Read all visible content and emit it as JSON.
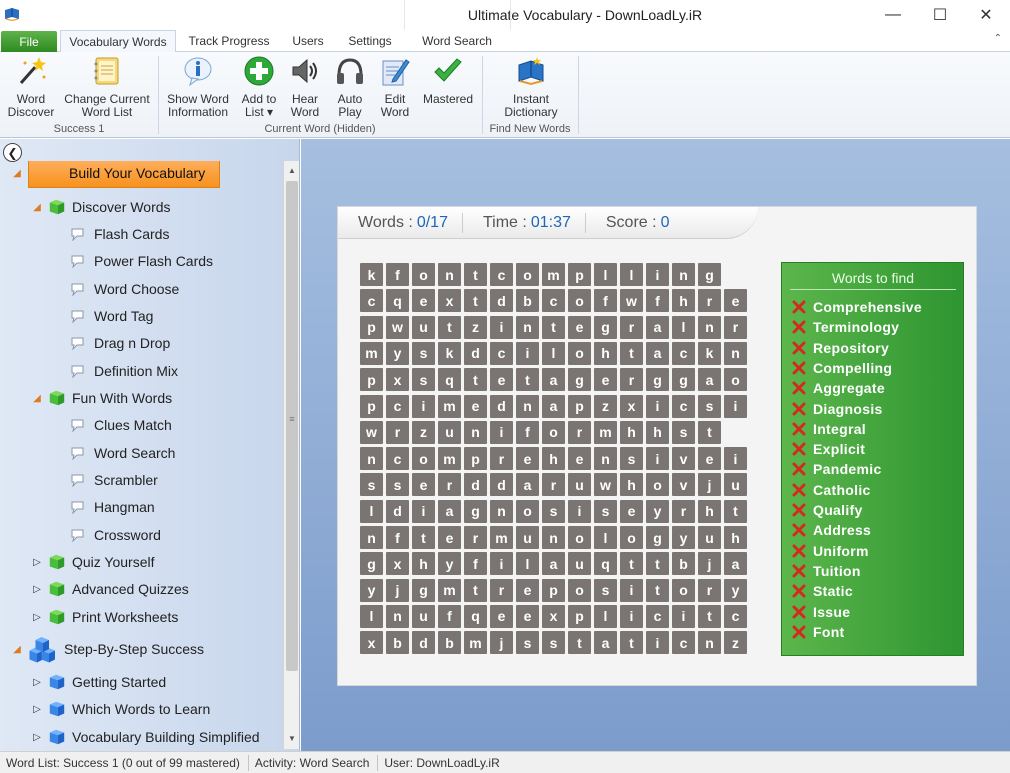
{
  "window": {
    "title": "Ultimate Vocabulary - DownLoadLy.iR",
    "minimize_glyph": "—",
    "maximize_glyph": "☐",
    "close_glyph": "✕"
  },
  "ribbon": {
    "file_label": "File",
    "tabs": [
      "Vocabulary Words",
      "Track Progress",
      "Users",
      "Settings",
      "Word Search"
    ],
    "active_tab": "Vocabulary Words",
    "collapse_glyph": "⌃",
    "buttons": {
      "word_discover": [
        "Word",
        "Discover"
      ],
      "change_list": [
        "Change Current",
        "Word List"
      ],
      "show_info": [
        "Show Word",
        "Information"
      ],
      "add_to_list": [
        "Add to",
        "List ▾"
      ],
      "hear_word": [
        "Hear",
        "Word"
      ],
      "auto_play": [
        "Auto",
        "Play"
      ],
      "edit_word": [
        "Edit",
        "Word"
      ],
      "mastered": [
        "Mastered",
        ""
      ],
      "instant_dictionary": [
        "Instant",
        "Dictionary"
      ]
    },
    "groups": {
      "success": "Success 1",
      "current_word": "Current Word (Hidden)",
      "find_new": "Find New Words"
    }
  },
  "tree": {
    "back_glyph": "❮",
    "items": [
      {
        "label": "Build Your Vocabulary",
        "level": 0,
        "arrow": "◢",
        "kind": "green-big",
        "selected": true
      },
      {
        "label": "Discover Words",
        "level": 1,
        "arrow": "◢",
        "kind": "green"
      },
      {
        "label": "Flash Cards",
        "level": 2,
        "kind": "leaf"
      },
      {
        "label": "Power Flash Cards",
        "level": 2,
        "kind": "leaf"
      },
      {
        "label": "Word Choose",
        "level": 2,
        "kind": "leaf"
      },
      {
        "label": "Word Tag",
        "level": 2,
        "kind": "leaf"
      },
      {
        "label": "Drag n Drop",
        "level": 2,
        "kind": "leaf"
      },
      {
        "label": "Definition Mix",
        "level": 2,
        "kind": "leaf"
      },
      {
        "label": "Fun With Words",
        "level": 1,
        "arrow": "◢",
        "kind": "green"
      },
      {
        "label": "Clues Match",
        "level": 2,
        "kind": "leaf"
      },
      {
        "label": "Word Search",
        "level": 2,
        "kind": "leaf"
      },
      {
        "label": "Scrambler",
        "level": 2,
        "kind": "leaf"
      },
      {
        "label": "Hangman",
        "level": 2,
        "kind": "leaf"
      },
      {
        "label": "Crossword",
        "level": 2,
        "kind": "leaf"
      },
      {
        "label": "Quiz Yourself",
        "level": 1,
        "arrow": "▷",
        "kind": "green"
      },
      {
        "label": "Advanced Quizzes",
        "level": 1,
        "arrow": "▷",
        "kind": "green"
      },
      {
        "label": "Print Worksheets",
        "level": 1,
        "arrow": "▷",
        "kind": "green"
      },
      {
        "label": "Step-By-Step Success",
        "level": 0,
        "arrow": "◢",
        "kind": "blue-big"
      },
      {
        "label": "Getting Started",
        "level": 1,
        "arrow": "▷",
        "kind": "blue"
      },
      {
        "label": "Which Words to Learn",
        "level": 1,
        "arrow": "▷",
        "kind": "blue"
      },
      {
        "label": "Vocabulary Building Simplified",
        "level": 1,
        "arrow": "▷",
        "kind": "blue"
      }
    ]
  },
  "game": {
    "words_label": "Words :",
    "words_value": "0/17",
    "time_label": "Time :",
    "time_value": "01:37",
    "score_label": "Score :",
    "score_value": "0",
    "grid": [
      "kfontcomplling",
      "cqextdbcofwfhre",
      "pwutzintegralnr",
      "myskdciloht ackn",
      "pxsqtetagerggao",
      "pcimednapzxicsi",
      "wrzunifor mhhst",
      "ncomprehensivei",
      "sserddaruwhovju",
      "ldiagnosiseyrht",
      "nftermunologyuh",
      "gxhyfilauqttbja",
      "yjgmtrepositor y",
      "lnufqeexplicitc",
      "xbdbmjsstaticnz"
    ],
    "words_title": "Words to find",
    "words": [
      "Comprehensive",
      "Terminology",
      "Repository",
      "Compelling",
      "Aggregate",
      "Diagnosis",
      "Integral",
      "Explicit",
      "Pandemic",
      "Catholic",
      "Qualify",
      "Address",
      "Uniform",
      "Tuition",
      "Static",
      "Issue",
      "Font"
    ]
  },
  "status": {
    "word_list": "Word List: Success 1 (0 out of 99 mastered)",
    "activity": "Activity: Word Search",
    "user": "User: DownLoadLy.iR"
  }
}
